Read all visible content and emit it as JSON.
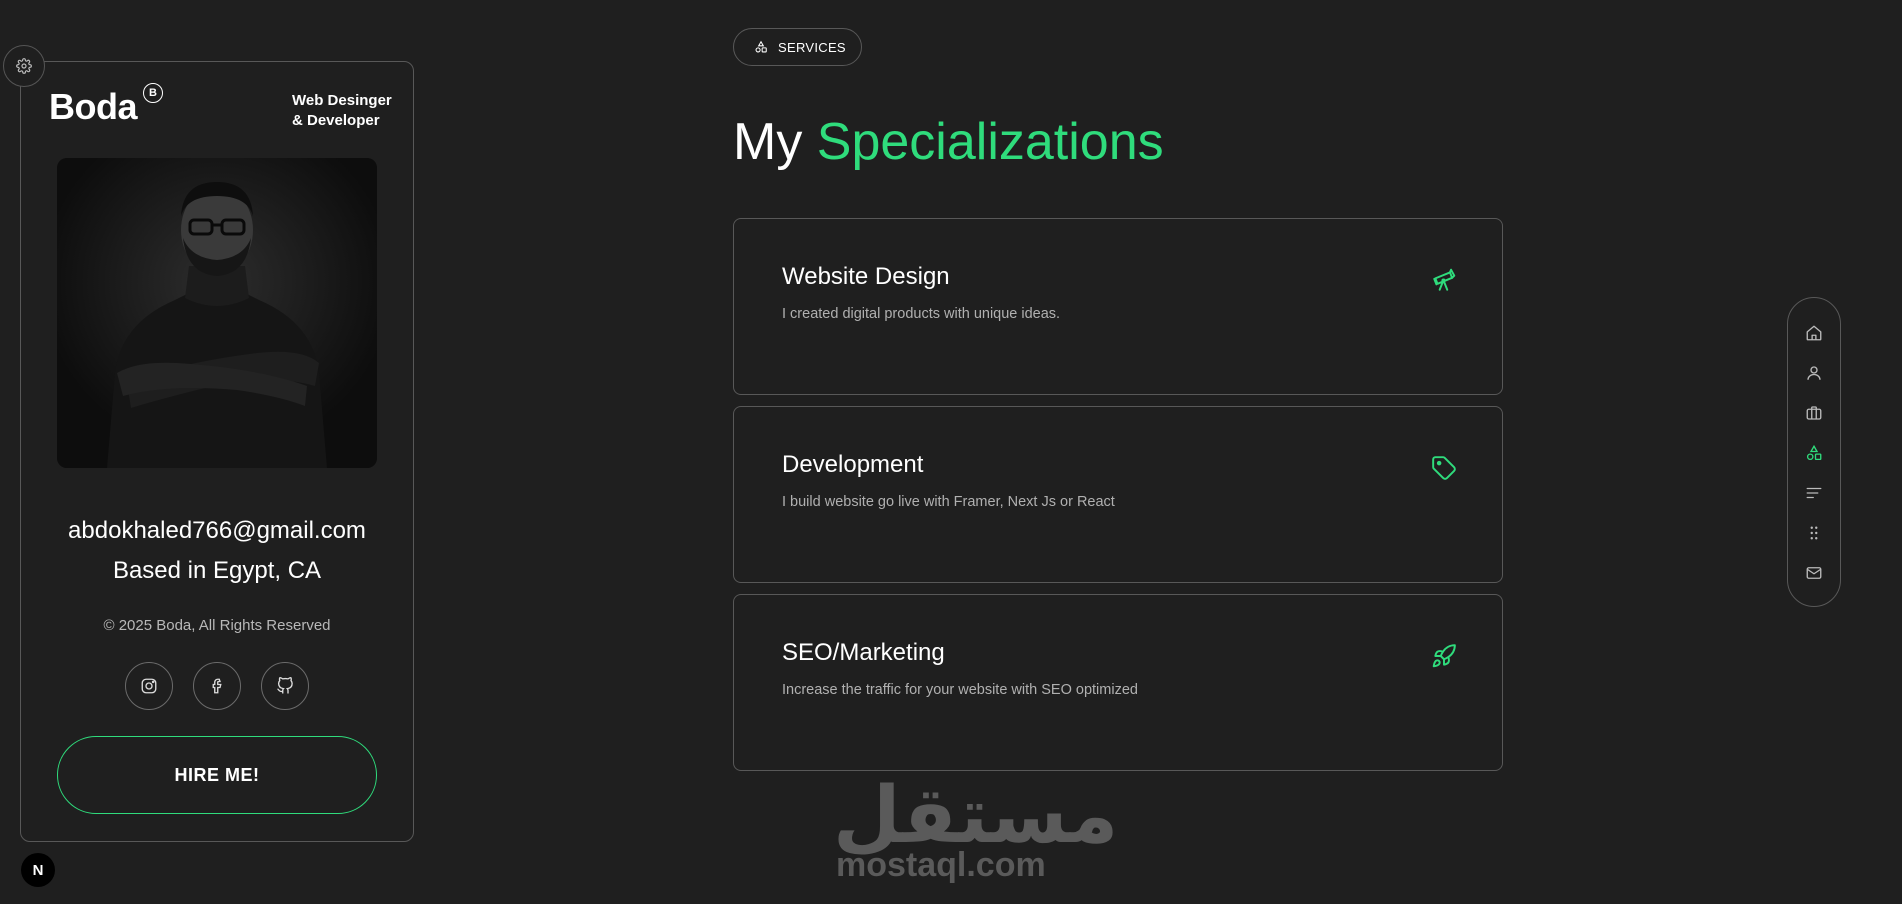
{
  "profile": {
    "logo": "Boda",
    "logo_badge": "B",
    "role_line1": "Web Desinger",
    "role_line2": "& Developer",
    "photo_icon": "portrait-photo",
    "email": "abdokhaled766@gmail.com",
    "location": "Based in Egypt, CA",
    "copyright": "© 2025 Boda, All Rights Reserved",
    "socials": [
      "instagram-icon",
      "facebook-icon",
      "github-icon"
    ],
    "hire_label": "HIRE ME!"
  },
  "settings_icon": "gear-icon",
  "framework_badge": "N",
  "section": {
    "pill_label": "SERVICES",
    "heading_plain": "My",
    "heading_accent": "Specializations"
  },
  "services": [
    {
      "title": "Website Design",
      "description": "I created digital products with unique ideas.",
      "icon": "telescope-icon"
    },
    {
      "title": "Development",
      "description": "I build website go live with Framer, Next Js or React",
      "icon": "tag-icon"
    },
    {
      "title": "SEO/Marketing",
      "description": "Increase the traffic for your website with SEO optimized",
      "icon": "rocket-icon"
    }
  ],
  "right_nav": {
    "items": [
      "home-icon",
      "user-icon",
      "briefcase-icon",
      "shapes-icon",
      "align-left-icon",
      "grid-dots-icon",
      "mail-icon"
    ],
    "active_item": "shapes-icon"
  },
  "colors": {
    "accent": "#2fdc7c",
    "background": "#1f1f1f",
    "border": "#585858"
  },
  "watermark": {
    "arabic": "مستقل",
    "latin": "mostaql.com"
  }
}
